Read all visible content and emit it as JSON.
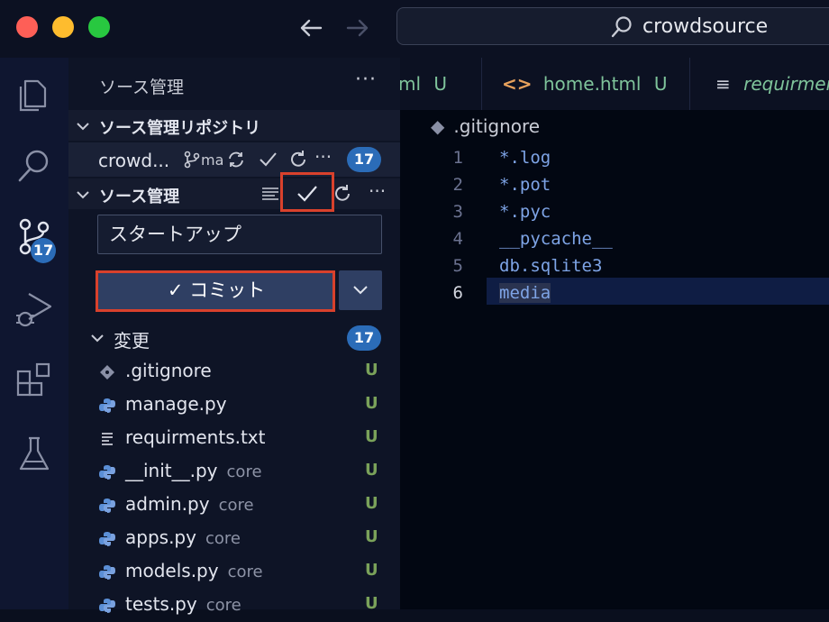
{
  "titlebar": {
    "search_text": "crowdsource"
  },
  "activity": {
    "scm_badge": "17"
  },
  "sidebar": {
    "title": "ソース管理",
    "more": "···",
    "repos_header": "ソース管理リポジトリ",
    "repo_name": "crowd...",
    "repo_branch": "ma",
    "repo_badge": "17",
    "scm_header": "ソース管理",
    "commit_message": "スタートアップ",
    "commit_label": "✓ コミット",
    "changes_header": "変更",
    "changes_badge": "17",
    "files": [
      {
        "name": ".gitignore",
        "dir": "",
        "status": "U",
        "icon": "git-icon"
      },
      {
        "name": "manage.py",
        "dir": "",
        "status": "U",
        "icon": "python-icon"
      },
      {
        "name": "requirments.txt",
        "dir": "",
        "status": "U",
        "icon": "text-lines-icon"
      },
      {
        "name": "__init__.py",
        "dir": "core",
        "status": "U",
        "icon": "python-icon"
      },
      {
        "name": "admin.py",
        "dir": "core",
        "status": "U",
        "icon": "python-icon"
      },
      {
        "name": "apps.py",
        "dir": "core",
        "status": "U",
        "icon": "python-icon"
      },
      {
        "name": "models.py",
        "dir": "core",
        "status": "U",
        "icon": "python-icon"
      },
      {
        "name": "tests.py",
        "dir": "core",
        "status": "U",
        "icon": "python-icon"
      }
    ]
  },
  "editor": {
    "tabs": [
      {
        "label": "ml",
        "status": "U"
      },
      {
        "label": "home.html",
        "status": "U"
      },
      {
        "label": "requirmen",
        "status": ""
      }
    ],
    "breadcrumb": ".gitignore",
    "lines": [
      {
        "n": "1",
        "text": "*.log"
      },
      {
        "n": "2",
        "text": "*.pot"
      },
      {
        "n": "3",
        "text": "*.pyc"
      },
      {
        "n": "4",
        "text": "__pycache__"
      },
      {
        "n": "5",
        "text": "db.sqlite3"
      },
      {
        "n": "6",
        "text": "media"
      }
    ]
  },
  "colors": {
    "accent": "#2b6cb8",
    "highlight_box": "#d9412c",
    "untracked": "#7aa25a",
    "tab_text": "#7fc49b"
  }
}
